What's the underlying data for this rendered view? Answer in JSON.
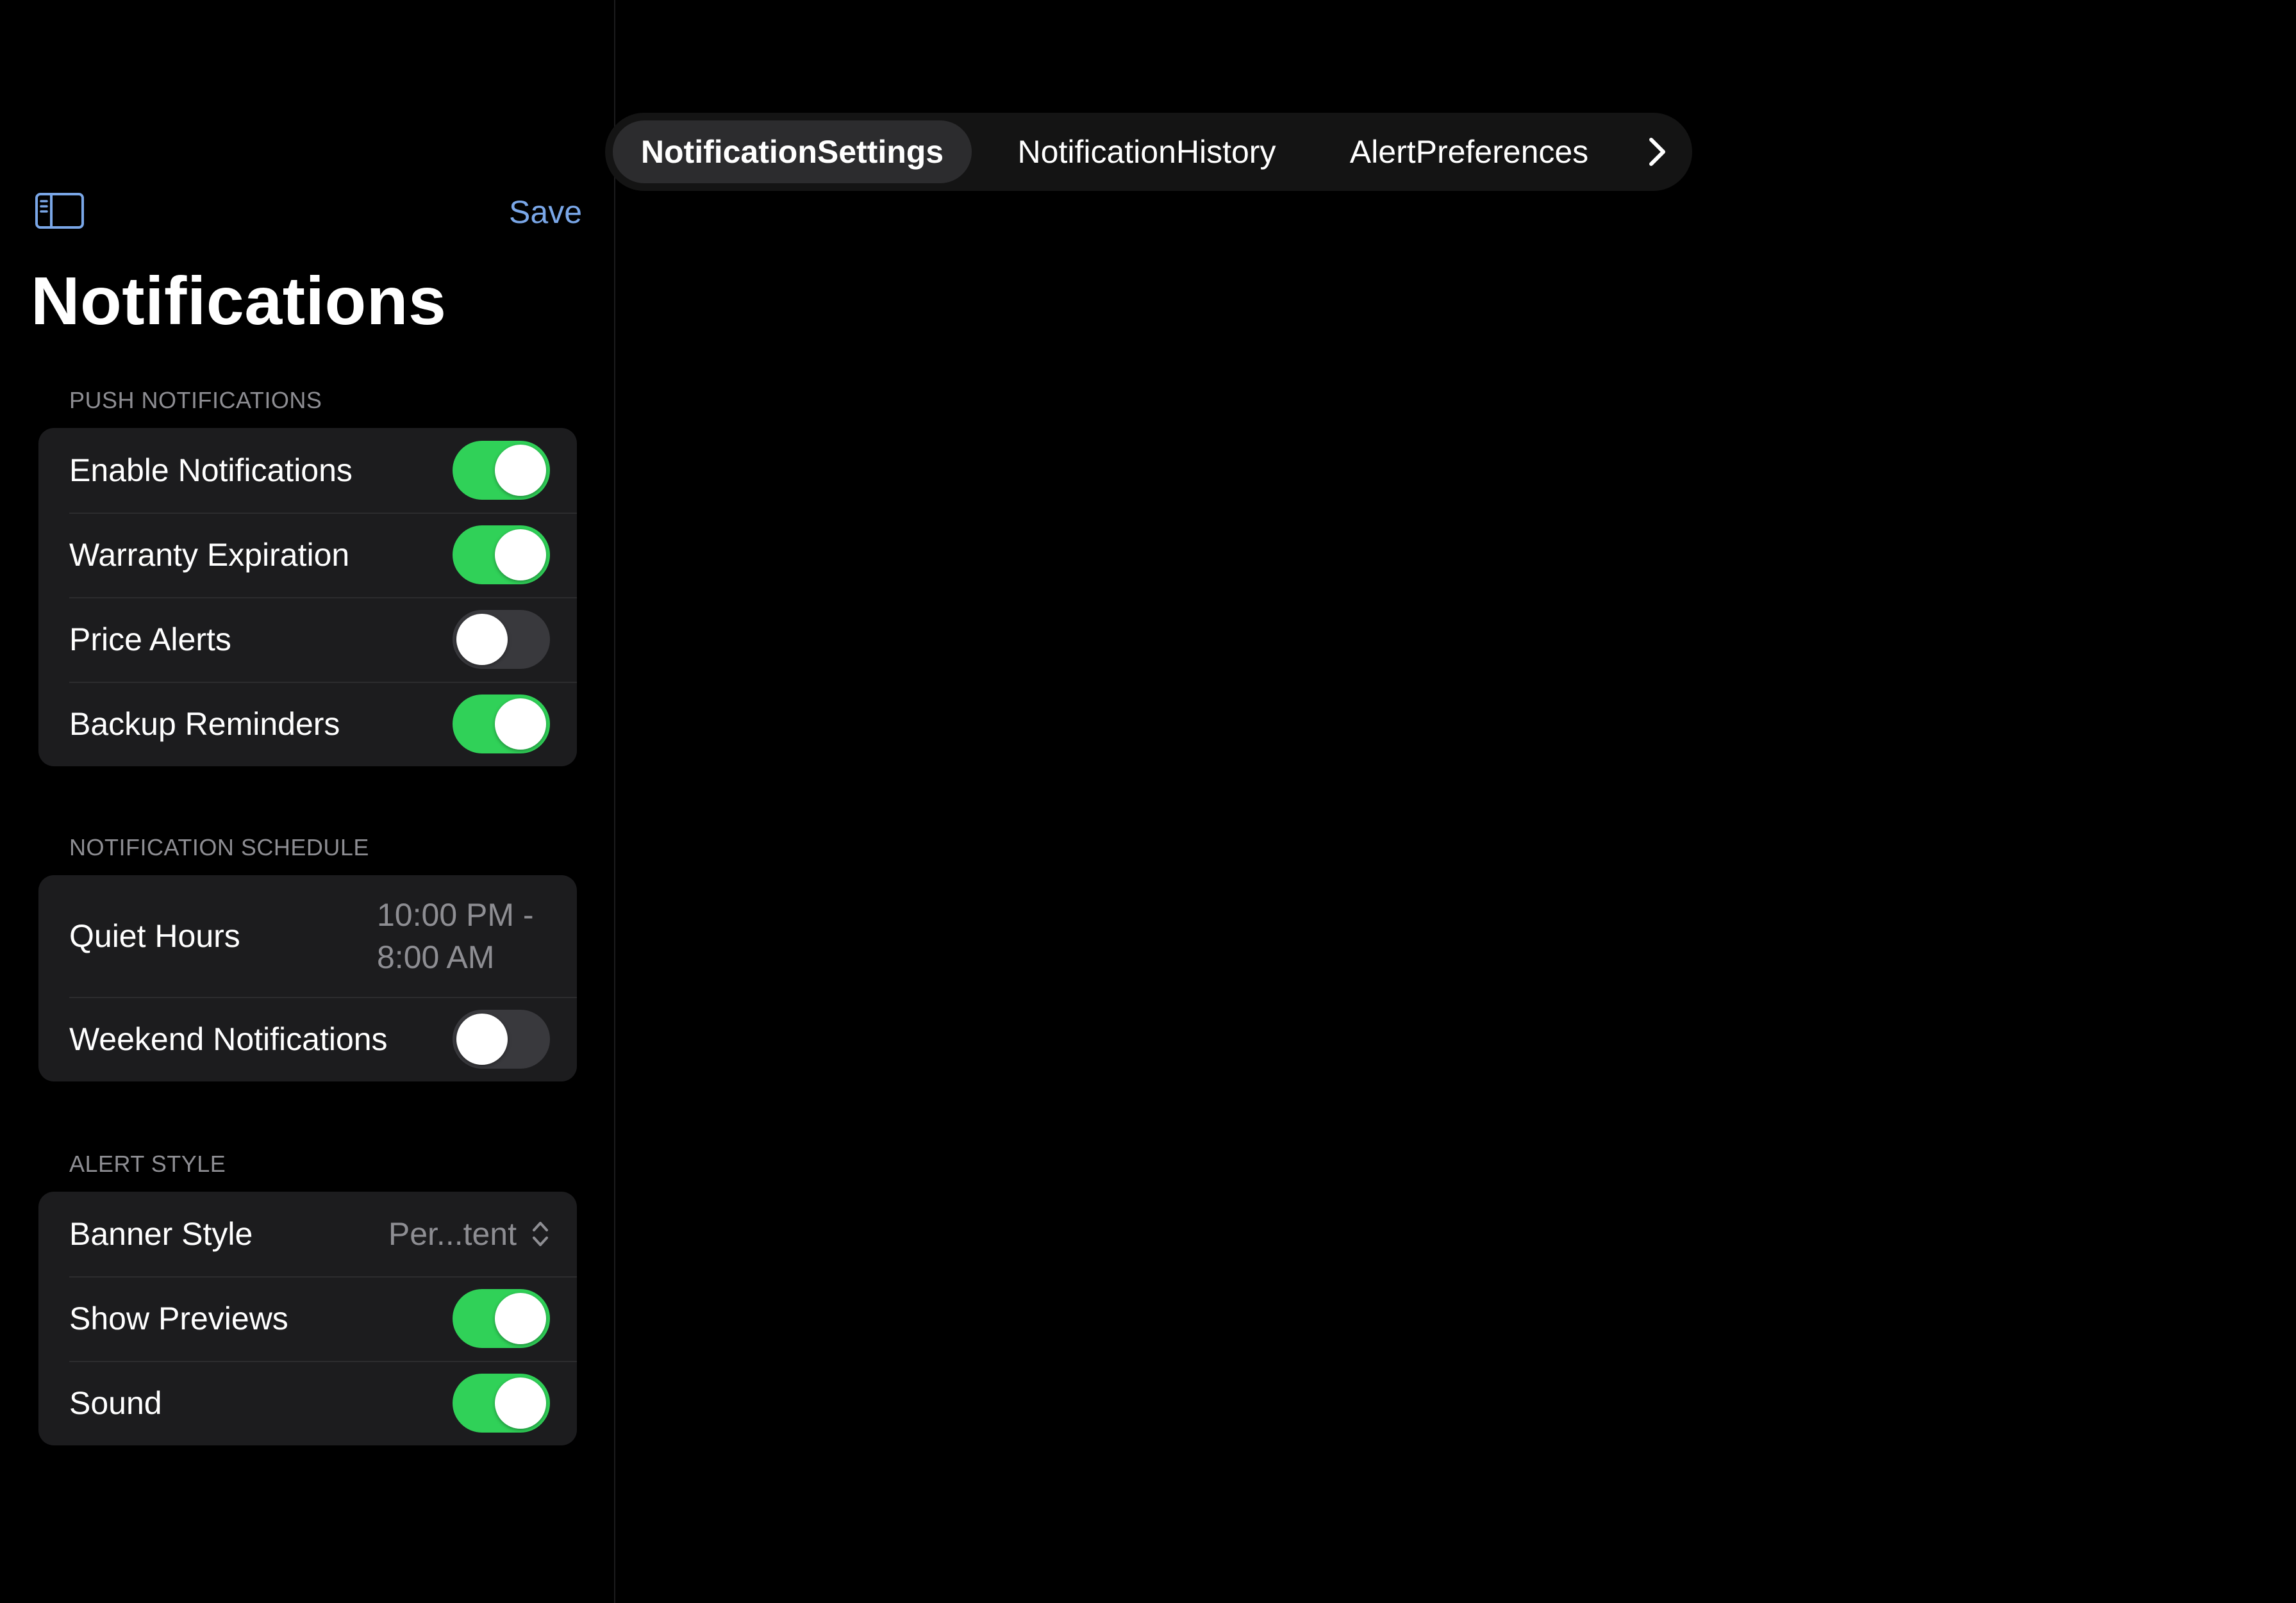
{
  "sidebar": {
    "toggle_icon": "sidebar-left-icon",
    "save_label": "Save",
    "title": "Notifications",
    "sections": {
      "push": {
        "header": "PUSH NOTIFICATIONS",
        "rows": [
          {
            "label": "Enable Notifications",
            "on": true
          },
          {
            "label": "Warranty Expiration",
            "on": true
          },
          {
            "label": "Price Alerts",
            "on": false
          },
          {
            "label": "Backup Reminders",
            "on": true
          }
        ]
      },
      "schedule": {
        "header": "NOTIFICATION SCHEDULE",
        "quiet_hours_label": "Quiet Hours",
        "quiet_hours_value_line1": "10:00 PM -",
        "quiet_hours_value_line2": "8:00 AM",
        "weekend_label": "Weekend Notifications",
        "weekend_on": false
      },
      "alert": {
        "header": "ALERT STYLE",
        "banner_label": "Banner Style",
        "banner_value": "Per...tent",
        "banner_icon": "chevron-up-down-icon",
        "rows": [
          {
            "label": "Show Previews",
            "on": true
          },
          {
            "label": "Sound",
            "on": true
          }
        ]
      }
    }
  },
  "tabs": {
    "items": [
      {
        "label": "NotificationSettings",
        "selected": true
      },
      {
        "label": "NotificationHistory",
        "selected": false
      },
      {
        "label": "AlertPreferences",
        "selected": false
      }
    ],
    "more_icon": "chevron-right-icon"
  },
  "colors": {
    "accent": "#7aa7e8",
    "toggle_on": "#30d158",
    "toggle_off": "#39393d",
    "group_bg": "#1c1c1e",
    "secondary_text": "#8e8e93"
  }
}
